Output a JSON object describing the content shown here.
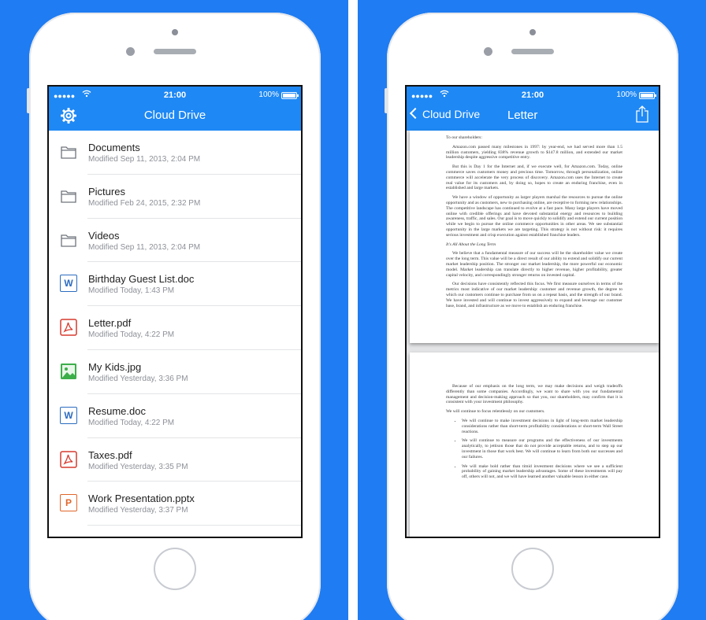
{
  "status": {
    "signal": "●●●●●",
    "time": "21:00",
    "battery": "100%"
  },
  "left": {
    "title": "Cloud Drive",
    "items": [
      {
        "name": "Documents",
        "meta": "Modified Sep 11, 2013, 2:04 PM",
        "icon": "folder-icon"
      },
      {
        "name": "Pictures",
        "meta": "Modified Feb 24, 2015, 2:32 PM",
        "icon": "folder-icon"
      },
      {
        "name": "Videos",
        "meta": "Modified Sep 11, 2013, 2:04 PM",
        "icon": "folder-icon"
      },
      {
        "name": "Birthday Guest List.doc",
        "meta": "Modified Today, 1:43 PM",
        "icon": "word-doc-icon",
        "badge": "W",
        "color": "#2b6cc0"
      },
      {
        "name": "Letter.pdf",
        "meta": "Modified Today, 4:22 PM",
        "icon": "pdf-icon",
        "color": "#d63a2f"
      },
      {
        "name": "My Kids.jpg",
        "meta": "Modified Yesterday, 3:36 PM",
        "icon": "image-icon",
        "color": "#3cae4a"
      },
      {
        "name": "Resume.doc",
        "meta": "Modified Today, 4:22 PM",
        "icon": "word-doc-icon",
        "badge": "W",
        "color": "#2b6cc0"
      },
      {
        "name": "Taxes.pdf",
        "meta": "Modified Yesterday, 3:35 PM",
        "icon": "pdf-icon",
        "color": "#d63a2f"
      },
      {
        "name": "Work Presentation.pptx",
        "meta": "Modified Yesterday, 3:37 PM",
        "icon": "powerpoint-icon",
        "badge": "P",
        "color": "#e0662a"
      }
    ]
  },
  "right": {
    "back_label": "Cloud Drive",
    "title": "Letter",
    "page1": {
      "salutation": "To our shareholders:",
      "p1": "Amazon.com passed many milestones in 1997: by year-end, we had served more than 1.5 million customers, yielding 838% revenue growth to $147.8 million, and extended our market leadership despite aggressive competitive entry.",
      "p2": "But this is Day 1 for the Internet and, if we execute well, for Amazon.com. Today, online commerce saves customers money and precious time. Tomorrow, through personalization, online commerce will accelerate the very process of discovery. Amazon.com uses the Internet to create real value for its customers and, by doing so, hopes to create an enduring franchise, even in established and large markets.",
      "p3": "We have a window of opportunity as larger players marshal the resources to pursue the online opportunity and as customers, new to purchasing online, are receptive to forming new relationships. The competitive landscape has continued to evolve at a fast pace. Many large players have moved online with credible offerings and have devoted substantial energy and resources to building awareness, traffic, and sales. Our goal is to move quickly to solidify and extend our current position while we begin to pursue the online commerce opportunities in other areas. We see substantial opportunity in the large markets we are targeting. This strategy is not without risk: it requires serious investment and crisp execution against established franchise leaders.",
      "heading": "It's All About the Long Term",
      "p4": "We believe that a fundamental measure of our success will be the shareholder value we create over the long term. This value will be a direct result of our ability to extend and solidify our current market leadership position. The stronger our market leadership, the more powerful our economic model. Market leadership can translate directly to higher revenue, higher profitability, greater capital velocity, and correspondingly stronger returns on invested capital.",
      "p5": "Our decisions have consistently reflected this focus. We first measure ourselves in terms of the metrics most indicative of our market leadership: customer and revenue growth, the degree to which our customers continue to purchase from us on a repeat basis, and the strength of our brand. We have invested and will continue to invest aggressively to expand and leverage our customer base, brand, and infrastructure as we move to establish an enduring franchise."
    },
    "page2": {
      "p1": "Because of our emphasis on the long term, we may make decisions and weigh tradeoffs differently than some companies. Accordingly, we want to share with you our fundamental management and decision-making approach so that you, our shareholders, may confirm that it is consistent with your investment philosophy.",
      "p2": "We will continue to focus relentlessly on our customers.",
      "b1": "We will continue to make investment decisions in light of long-term market leadership considerations rather than short-term profitability considerations or short-term Wall Street reactions.",
      "b2": "We will continue to measure our programs and the effectiveness of our investments analytically, to jettison those that do not provide acceptable returns, and to step up our investment in those that work best. We will continue to learn from both our successes and our failures.",
      "b3": "We will make bold rather than timid investment decisions where we see a sufficient probability of gaining market leadership advantages. Some of these investments will pay off, others will not, and we will have learned another valuable lesson in either case."
    }
  }
}
